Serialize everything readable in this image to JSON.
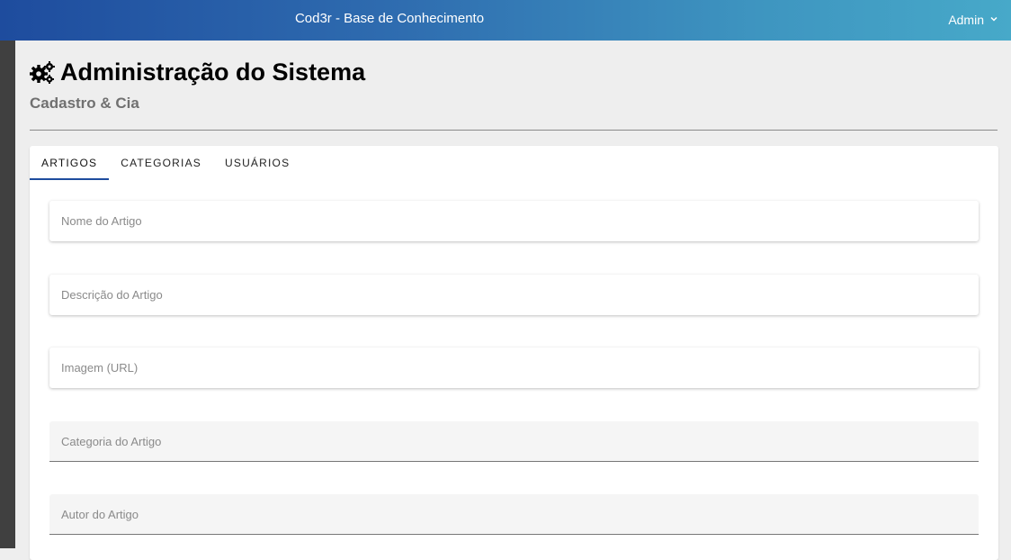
{
  "header": {
    "title": "Cod3r - Base de Conhecimento",
    "user_name": "Admin"
  },
  "page": {
    "title": "Administração do Sistema",
    "subtitle": "Cadastro & Cia",
    "title_icon": "cogs-icon"
  },
  "tabs": [
    {
      "label": "ARTIGOS",
      "active": true
    },
    {
      "label": "CATEGORIAS",
      "active": false
    },
    {
      "label": "USUÁRIOS",
      "active": false
    }
  ],
  "form": {
    "name_placeholder": "Nome do Artigo",
    "description_placeholder": "Descrição do Artigo",
    "image_placeholder": "Imagem (URL)",
    "category_placeholder": "Categoria do Artigo",
    "author_placeholder": "Autor do Artigo"
  },
  "colors": {
    "header_gradient_start": "#1e4c9e",
    "header_gradient_end": "#47a9c9",
    "left_rail": "#404040",
    "background": "#eeeeee"
  }
}
